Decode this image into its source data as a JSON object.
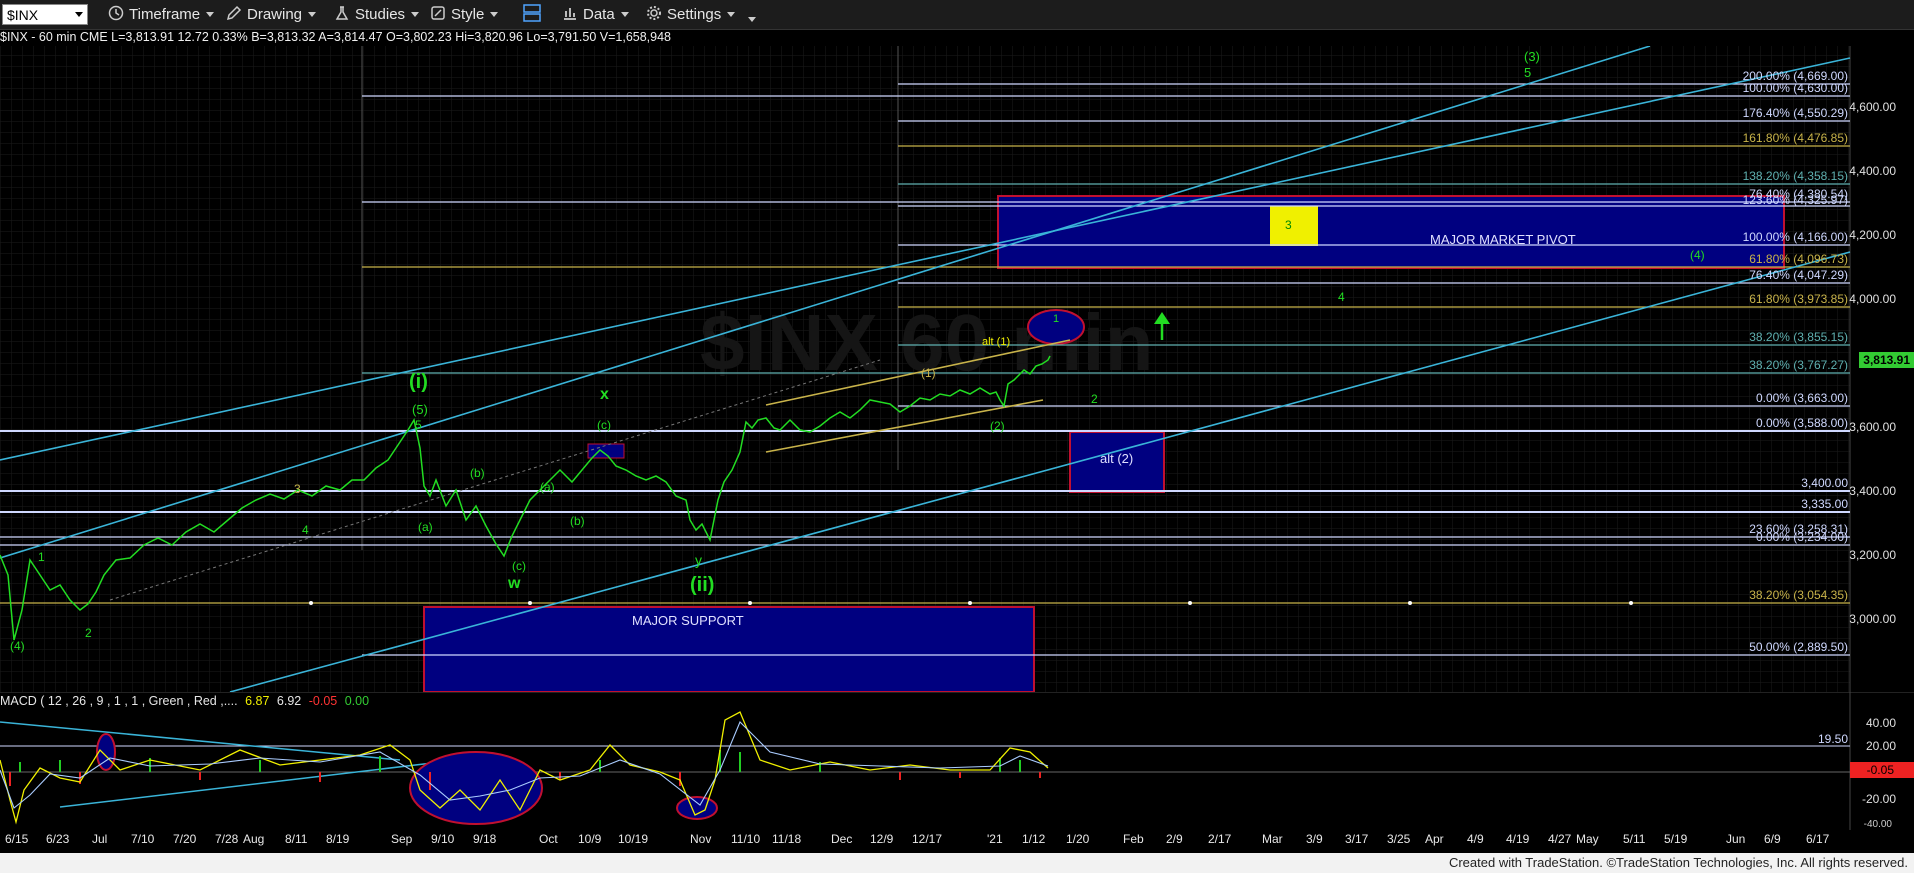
{
  "toolbar": {
    "symbol": "$INX",
    "items": [
      {
        "label": "Timeframe",
        "icon": "clock-icon"
      },
      {
        "label": "Drawing",
        "icon": "pencil-icon"
      },
      {
        "label": "Studies",
        "icon": "flask-icon"
      },
      {
        "label": "Style",
        "icon": "brush-icon"
      },
      {
        "label": "Data",
        "icon": "bar-chart-icon"
      },
      {
        "label": "Settings",
        "icon": "gear-icon"
      }
    ]
  },
  "infobar": "$INX - 60 min  CME  L=3,813.91  12.72  0.33%  B=3,813.32  A=3,814.47  O=3,802.23  Hi=3,820.96  Lo=3,791.50  V=1,658,948",
  "price_axis": {
    "ticks": [
      "4,600.00",
      "4,400.00",
      "4,200.00",
      "4,000.00",
      "3,800.00",
      "3,600.00",
      "3,400.00",
      "3,200.00",
      "3,000.00"
    ],
    "last_price": "3,813.91",
    "last_price_color": "#33cc33"
  },
  "fib_levels": [
    {
      "label": "200.00% (4,669.00)",
      "color": "#cfd8ff"
    },
    {
      "label": "100.00% (4,630.00)",
      "color": "#cfd8ff"
    },
    {
      "label": "176.40% (4,550.29)",
      "color": "#cfd8ff"
    },
    {
      "label": "161.80% (4,476.85)",
      "color": "#c8b34a"
    },
    {
      "label": "138.20% (4,358.15)",
      "color": "#5fb0b0"
    },
    {
      "label": "76.40% (4,380.54)",
      "color": "#cfd8ff"
    },
    {
      "label": "123.60% (4,325.97)",
      "color": "#cfd8ff"
    },
    {
      "label": "100.00% (4,166.00)",
      "color": "#cfd8ff"
    },
    {
      "label": "61.80% (4,096.73)",
      "color": "#c8b34a"
    },
    {
      "label": "76.40% (4,047.29)",
      "color": "#cfd8ff"
    },
    {
      "label": "61.80% (3,973.85)",
      "color": "#c8b34a"
    },
    {
      "label": "38.20% (3,855.15)",
      "color": "#5fb0b0"
    },
    {
      "label": "38.20% (3,767.27)",
      "color": "#5fb0b0"
    },
    {
      "label": "0.00% (3,663.00)",
      "color": "#cfd8ff"
    },
    {
      "label": "0.00% (3,588.00)",
      "color": "#cfd8ff"
    },
    {
      "label": "3,400.00",
      "color": "#cfd8ff"
    },
    {
      "label": "3,335.00",
      "color": "#cfd8ff"
    },
    {
      "label": "23.60% (3,258.31)",
      "color": "#cfd8ff"
    },
    {
      "label": "0.00% (3,234.00)",
      "color": "#cfd8ff"
    },
    {
      "label": "38.20% (3,054.35)",
      "color": "#c8b34a"
    },
    {
      "label": "50.00% (2,889.50)",
      "color": "#cfd8ff"
    }
  ],
  "zones": {
    "major_market_pivot": "MAJOR MARKET PIVOT",
    "major_support": "MAJOR SUPPORT",
    "alt_2": "alt (2)",
    "wave_3_box": "3"
  },
  "wave_labels": [
    "(4)",
    "1",
    "2",
    "3",
    "4",
    "(5)",
    "5",
    "(i)",
    "(a)",
    "(b)",
    "(c)",
    "w",
    "x",
    "(a)",
    "(b)",
    "(c)",
    "y",
    "(ii)",
    "(1)",
    "(2)",
    "alt (1)",
    "1",
    "2",
    "4",
    "(4)",
    "(3)",
    "5"
  ],
  "macd": {
    "label": "MACD ( 12 , 26 , 9 , 1 , 1 , Green , Red ,....",
    "values": [
      "6.87",
      "6.92",
      "-0.05",
      "0.00"
    ],
    "value_colors": [
      "#f0f000",
      "#e6e6e6",
      "#ff3333",
      "#33cc33"
    ],
    "ticks": [
      "40.00",
      "20.00",
      "-20.00"
    ],
    "level_19_50": "19.50",
    "current": "-0.05",
    "cut_tick": "-40.00"
  },
  "date_axis": [
    "6/15",
    "6/23",
    "Jul",
    "7/10",
    "7/20",
    "7/28",
    "Aug",
    "8/11",
    "8/19",
    "Sep",
    "9/10",
    "9/18",
    "Oct",
    "10/9",
    "10/19",
    "Nov",
    "11/10",
    "11/18",
    "Dec",
    "12/9",
    "12/17",
    "'21",
    "1/12",
    "1/20",
    "Feb",
    "2/9",
    "2/17",
    "Mar",
    "3/9",
    "3/17",
    "3/25",
    "Apr",
    "4/9",
    "4/19",
    "4/27",
    "May",
    "5/11",
    "5/19",
    "Jun",
    "6/9",
    "6/17"
  ],
  "watermark": "$INX 60 min",
  "footer": "Created with TradeStation. ©TradeStation Technologies, Inc. All rights reserved."
}
